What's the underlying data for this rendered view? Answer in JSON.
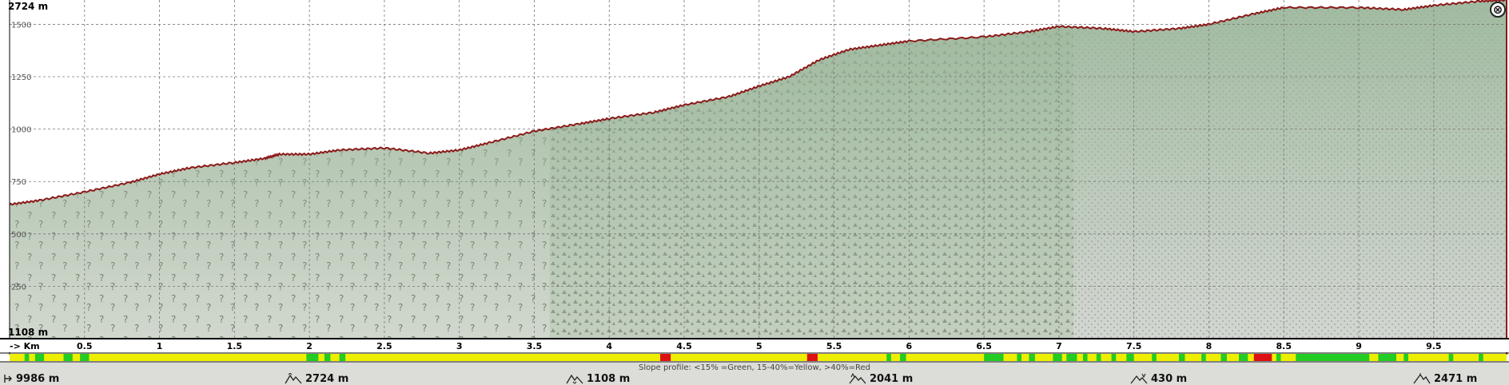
{
  "window": {
    "close_label": "⊗"
  },
  "chart_data": {
    "type": "area",
    "y_top_label": "2724 m",
    "y_bottom_label": "1108 m",
    "x_axis_label": "-> Km",
    "x_ticks": [
      0.5,
      1,
      1.5,
      2,
      2.5,
      3,
      3.5,
      4,
      4.5,
      5,
      5.5,
      6,
      6.5,
      7,
      7.5,
      8,
      8.5,
      9,
      9.5
    ],
    "y_ticks": [
      250,
      500,
      750,
      1000,
      1250,
      1500
    ],
    "xlim": [
      0,
      9.986
    ],
    "ylim": [
      0,
      1616
    ],
    "grid": true,
    "elevation_profile": {
      "x": [
        0,
        0.2,
        0.5,
        0.8,
        1.0,
        1.2,
        1.5,
        1.7,
        1.8,
        2.0,
        2.2,
        2.5,
        2.8,
        3.0,
        3.2,
        3.5,
        3.8,
        4.0,
        4.3,
        4.5,
        4.8,
        5.0,
        5.2,
        5.4,
        5.6,
        5.8,
        6.0,
        6.5,
        6.8,
        7.0,
        7.3,
        7.5,
        7.8,
        8.0,
        8.3,
        8.5,
        9.0,
        9.3,
        9.5,
        9.8,
        9.986
      ],
      "values": [
        640,
        660,
        700,
        745,
        785,
        815,
        840,
        860,
        880,
        880,
        900,
        910,
        885,
        900,
        935,
        990,
        1025,
        1050,
        1080,
        1115,
        1155,
        1205,
        1250,
        1330,
        1380,
        1400,
        1420,
        1440,
        1465,
        1490,
        1480,
        1465,
        1480,
        1500,
        1550,
        1580,
        1580,
        1570,
        1590,
        1610,
        1616
      ]
    },
    "slope_legend": "Slope profile: <15% =Green, 15-40%=Yellow, >40%=Red",
    "slope_colors": {
      "low": "#22cc22",
      "mid": "#eeee00",
      "high": "#dd1111"
    },
    "slope_segments": [
      {
        "from": 0.1,
        "to": 0.13,
        "level": "low"
      },
      {
        "from": 0.17,
        "to": 0.23,
        "level": "low"
      },
      {
        "from": 0.36,
        "to": 0.42,
        "level": "low"
      },
      {
        "from": 0.47,
        "to": 0.53,
        "level": "low"
      },
      {
        "from": 1.98,
        "to": 2.06,
        "level": "low"
      },
      {
        "from": 2.1,
        "to": 2.14,
        "level": "low"
      },
      {
        "from": 2.2,
        "to": 2.24,
        "level": "low"
      },
      {
        "from": 4.34,
        "to": 4.41,
        "level": "high"
      },
      {
        "from": 5.32,
        "to": 5.39,
        "level": "high"
      },
      {
        "from": 5.85,
        "to": 5.88,
        "level": "low"
      },
      {
        "from": 5.94,
        "to": 5.98,
        "level": "low"
      },
      {
        "from": 6.5,
        "to": 6.63,
        "level": "low"
      },
      {
        "from": 6.72,
        "to": 6.75,
        "level": "low"
      },
      {
        "from": 6.8,
        "to": 6.84,
        "level": "low"
      },
      {
        "from": 6.96,
        "to": 7.02,
        "level": "low"
      },
      {
        "from": 7.05,
        "to": 7.12,
        "level": "low"
      },
      {
        "from": 7.16,
        "to": 7.19,
        "level": "low"
      },
      {
        "from": 7.25,
        "to": 7.28,
        "level": "low"
      },
      {
        "from": 7.35,
        "to": 7.38,
        "level": "low"
      },
      {
        "from": 7.45,
        "to": 7.5,
        "level": "low"
      },
      {
        "from": 7.62,
        "to": 7.65,
        "level": "low"
      },
      {
        "from": 7.8,
        "to": 7.84,
        "level": "low"
      },
      {
        "from": 7.95,
        "to": 7.98,
        "level": "low"
      },
      {
        "from": 8.08,
        "to": 8.12,
        "level": "low"
      },
      {
        "from": 8.2,
        "to": 8.26,
        "level": "low"
      },
      {
        "from": 8.3,
        "to": 8.42,
        "level": "high"
      },
      {
        "from": 8.45,
        "to": 8.48,
        "level": "low"
      },
      {
        "from": 8.58,
        "to": 9.07,
        "level": "low"
      },
      {
        "from": 9.13,
        "to": 9.25,
        "level": "low"
      },
      {
        "from": 9.3,
        "to": 9.33,
        "level": "low"
      },
      {
        "from": 9.6,
        "to": 9.63,
        "level": "low"
      },
      {
        "from": 9.8,
        "to": 9.83,
        "level": "low"
      }
    ]
  },
  "stats": {
    "distance": "9986 m",
    "max_elevation": "2724 m",
    "min_elevation": "1108 m",
    "total_ascent": "2041 m",
    "total_descent": "430 m",
    "end_elevation": "2471 m"
  },
  "colors": {
    "fill": "#a4bca4",
    "profile_line": "#8b1a1a",
    "grid": "#777777",
    "axis": "#000000",
    "background": "#ffffff",
    "bottom_band": "#dcdcd8"
  }
}
